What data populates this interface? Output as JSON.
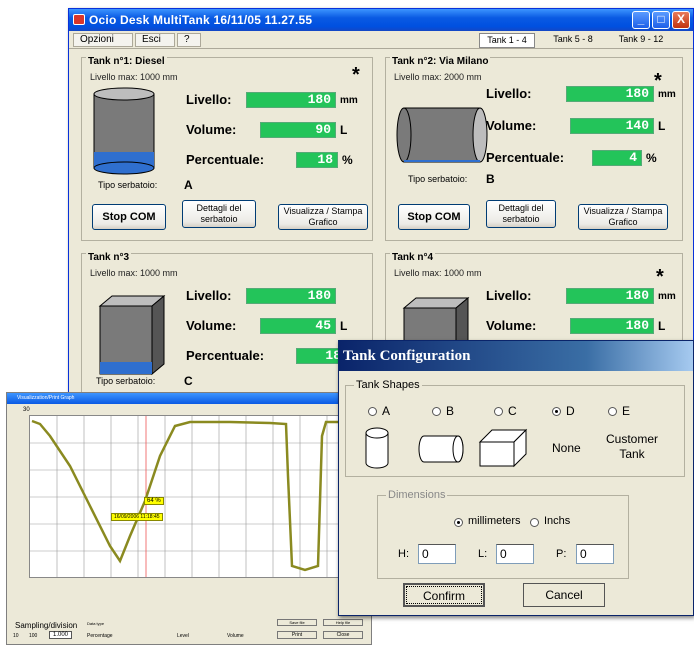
{
  "window": {
    "title": "Ocio Desk MultiTank 16/11/05  11.27.55",
    "min": "_",
    "max": "□",
    "close": "X"
  },
  "menu": {
    "opzioni": "Opzioni",
    "esci": "Esci",
    "help": "?"
  },
  "tabs": [
    "Tank 1 - 4",
    "Tank 5 - 8",
    "Tank 9 - 12"
  ],
  "tanks": [
    {
      "title": "Tank n°1: Diesel",
      "level_max": "Livello max: 1000 mm",
      "star": "*",
      "livello_label": "Livello:",
      "livello": "180",
      "livello_unit": "mm",
      "volume_label": "Volume:",
      "volume": "90",
      "volume_unit": "L",
      "perc_label": "Percentuale:",
      "perc": "18",
      "perc_unit": "%",
      "tipo_label": "Tipo serbatoio:",
      "tipo": "A",
      "btn_stop": "Stop COM",
      "btn_dettagli": "Dettagli del serbatoio",
      "btn_grafico": "Visualizza / Stampa Grafico",
      "fill_pct": 18
    },
    {
      "title": "Tank n°2: Via Milano",
      "level_max": "Livello max: 2000 mm",
      "star": "*",
      "livello_label": "Livello:",
      "livello": "180",
      "livello_unit": "mm",
      "volume_label": "Volume:",
      "volume": "140",
      "volume_unit": "L",
      "perc_label": "Percentuale:",
      "perc": "4",
      "perc_unit": "%",
      "tipo_label": "Tipo serbatoio:",
      "tipo": "B",
      "btn_stop": "Stop COM",
      "btn_dettagli": "Dettagli del serbatoio",
      "btn_grafico": "Visualizza / Stampa Grafico",
      "fill_pct": 4
    },
    {
      "title": "Tank n°3",
      "level_max": "Livello max: 1000 mm",
      "livello_label": "Livello:",
      "livello": "180",
      "livello_unit": "mm",
      "volume_label": "Volume:",
      "volume": "45",
      "volume_unit": "L",
      "perc_label": "Percentuale:",
      "perc": "18",
      "tipo_label": "Tipo serbatoio:",
      "tipo": "C",
      "fill_pct": 18
    },
    {
      "title": "Tank n°4",
      "level_max": "Livello max: 1000 mm",
      "star": "*",
      "livello_label": "Livello:",
      "livello": "180",
      "livello_unit": "mm",
      "volume_label": "Volume:",
      "volume": "180",
      "volume_unit": "L"
    }
  ],
  "graph": {
    "title": "Visualizzation/Print Graph",
    "ymax": "30",
    "marker_pct": "64 %",
    "marker_time": "16/09/2006 11:18:45",
    "sampling_label": "Sampling/division",
    "sampling_value": "1.000",
    "sampling_btns": [
      "10",
      "100"
    ],
    "data_type_label": "Data type",
    "options": [
      "Percentage",
      "Level",
      "Volume"
    ],
    "btns": [
      "Save file",
      "Help file",
      "Print",
      "Close"
    ]
  },
  "dialog": {
    "title": "Tank Configuration",
    "shapes_label": "Tank Shapes",
    "shapes": [
      "A",
      "B",
      "C",
      "D",
      "E"
    ],
    "selected": "D",
    "none_label": "None",
    "customer_label": "Customer Tank",
    "dims_label": "Dimensions",
    "unit_mm": "millimeters",
    "unit_in": "Inchs",
    "h_label": "H:",
    "l_label": "L:",
    "p_label": "P:",
    "h": "0",
    "l": "0",
    "p": "0",
    "confirm": "Confirm",
    "cancel": "Cancel"
  }
}
